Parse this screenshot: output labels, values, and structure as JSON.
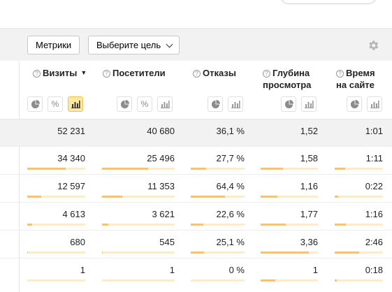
{
  "toolbar": {
    "metrics_label": "Метрики",
    "goal_label": "Выберите цель"
  },
  "columns": [
    {
      "label": "Визиты",
      "sorted": true,
      "sort_symbol": "▼"
    },
    {
      "label": "Посетители"
    },
    {
      "label": "Отказы"
    },
    {
      "label": "Глубина просмотра"
    },
    {
      "label": "Время на сайте"
    }
  ],
  "icons": {
    "help": "question-circle-icon",
    "pie": "pie-chart-icon",
    "percent": "percent-icon",
    "bars": "bar-chart-icon",
    "settings": "gear-icon"
  },
  "percent_symbol": "%",
  "help_symbol": "?",
  "colors": {
    "bar": "#f3c27b",
    "bar_track": "#fbecd0",
    "active_toggle": "#fde8a0",
    "total_row": "#f2f2f2"
  },
  "totals": [
    "52 231",
    "40 680",
    "36,1 %",
    "1,52",
    "1:01"
  ],
  "rows": [
    {
      "cells": [
        "34 340",
        "25 496",
        "27,7 %",
        "1,58",
        "1:11"
      ],
      "fill": [
        0.66,
        0.63,
        0.28,
        0.39,
        0.22
      ]
    },
    {
      "cells": [
        "12 597",
        "11 353",
        "64,4 %",
        "1,16",
        "0:22"
      ],
      "fill": [
        0.24,
        0.28,
        0.64,
        0.29,
        0.07
      ]
    },
    {
      "cells": [
        "4 613",
        "3 621",
        "22,6 %",
        "1,77",
        "1:16"
      ],
      "fill": [
        0.09,
        0.09,
        0.23,
        0.44,
        0.23
      ]
    },
    {
      "cells": [
        "680",
        "545",
        "25,1 %",
        "3,36",
        "2:46"
      ],
      "fill": [
        0.01,
        0.01,
        0.25,
        0.84,
        0.5
      ]
    },
    {
      "cells": [
        "1",
        "1",
        "0 %",
        "1",
        "0:18"
      ],
      "fill": [
        0.0,
        0.0,
        0.0,
        0.25,
        0.05
      ]
    }
  ]
}
